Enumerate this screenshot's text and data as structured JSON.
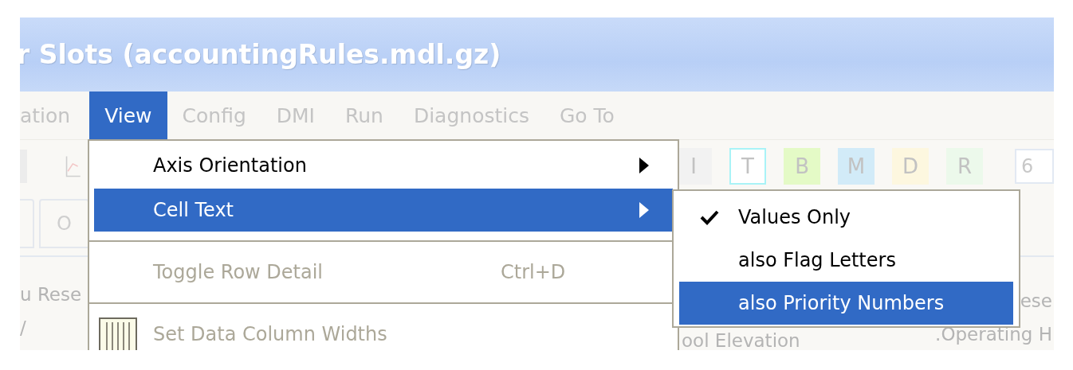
{
  "window": {
    "title": "r Slots (accountingRules.mdl.gz)"
  },
  "menubar": [
    {
      "label": "ation",
      "selected": false
    },
    {
      "label": "View",
      "selected": true
    },
    {
      "label": "Config",
      "selected": false
    },
    {
      "label": "DMI",
      "selected": false
    },
    {
      "label": "Run",
      "selected": false
    },
    {
      "label": "Diagnostics",
      "selected": false
    },
    {
      "label": "Go To",
      "selected": false
    }
  ],
  "toolbar": {
    "flag_buttons": [
      {
        "label": "I",
        "color": "#f2f2f2",
        "selected": false
      },
      {
        "label": "T",
        "color": "#ffffff",
        "selected": true
      },
      {
        "label": "B",
        "color": "#e4fac6",
        "selected": false
      },
      {
        "label": "M",
        "color": "#d2ebf8",
        "selected": false
      },
      {
        "label": "D",
        "color": "#fdf7df",
        "selected": false
      },
      {
        "label": "R",
        "color": "#ecf9eb",
        "selected": false
      }
    ],
    "field_value": "6"
  },
  "tab": {
    "label": "O"
  },
  "columns": [
    {
      "line_1": "u Rese",
      "line_2": "/"
    },
    {
      "line_1": "ool Elevation"
    },
    {
      "line_1": "ese",
      "line_2": ".Operating H"
    }
  ],
  "view_menu": [
    {
      "kind": "submenu",
      "label": "Axis Orientation",
      "selected": false
    },
    {
      "kind": "submenu",
      "label": "Cell Text",
      "selected": true
    },
    {
      "kind": "separator"
    },
    {
      "kind": "command",
      "label": "Toggle Row Detail",
      "shortcut": "Ctrl+D",
      "disabled": true
    },
    {
      "kind": "separator"
    },
    {
      "kind": "icon_command",
      "label": "Set Data Column Widths",
      "disabled": true
    }
  ],
  "cell_text_menu": [
    {
      "label": "Values Only",
      "checked": true,
      "selected": false
    },
    {
      "label": "also Flag Letters",
      "checked": false,
      "selected": false
    },
    {
      "label": "also Priority Numbers",
      "checked": false,
      "selected": true
    }
  ]
}
